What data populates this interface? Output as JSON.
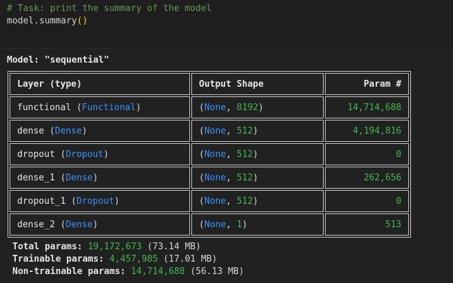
{
  "code": {
    "comment": "# Task: print the summary of the model",
    "call_object": "model.summary",
    "call_parens": "()"
  },
  "output": {
    "model_title": "Model: \"sequential\"",
    "headers": [
      "Layer (type)",
      "Output Shape",
      "Param #"
    ],
    "rows": [
      {
        "name": "functional",
        "cls": "Functional",
        "shape_none": "None",
        "shape_dim": "8192",
        "params": "14,714,688"
      },
      {
        "name": "dense",
        "cls": "Dense",
        "shape_none": "None",
        "shape_dim": "512",
        "params": "4,194,816"
      },
      {
        "name": "dropout",
        "cls": "Dropout",
        "shape_none": "None",
        "shape_dim": "512",
        "params": "0"
      },
      {
        "name": "dense_1",
        "cls": "Dense",
        "shape_none": "None",
        "shape_dim": "512",
        "params": "262,656"
      },
      {
        "name": "dropout_1",
        "cls": "Dropout",
        "shape_none": "None",
        "shape_dim": "512",
        "params": "0"
      },
      {
        "name": "dense_2",
        "cls": "Dense",
        "shape_none": "None",
        "shape_dim": "1",
        "params": "513"
      }
    ],
    "totals": [
      {
        "label": "Total params:",
        "value": "19,172,673",
        "size": "(73.14 MB)"
      },
      {
        "label": "Trainable params:",
        "value": "4,457,985",
        "size": "(17.01 MB)"
      },
      {
        "label": "Non-trainable params:",
        "value": "14,714,688",
        "size": "(56.13 MB)"
      }
    ]
  },
  "colors": {
    "background": "#1f1f1f",
    "comment": "#6a9955",
    "class_name": "#3794ff",
    "number": "#3fb950",
    "paren": "#ffd700"
  }
}
